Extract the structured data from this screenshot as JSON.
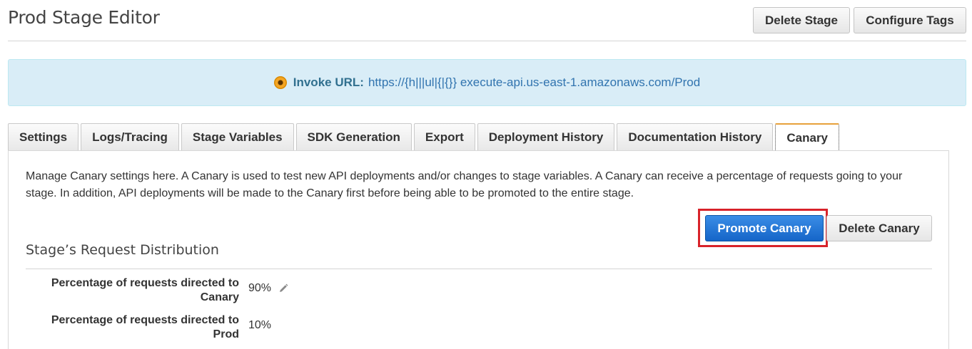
{
  "header": {
    "title": "Prod Stage Editor",
    "delete_stage_label": "Delete Stage",
    "configure_tags_label": "Configure Tags"
  },
  "invoke": {
    "label": "Invoke URL:",
    "url": "https://{h|||ul|{|{}} execute-api.us-east-1.amazonaws.com/Prod",
    "icon": "info-icon"
  },
  "tabs": [
    {
      "label": "Settings",
      "active": false
    },
    {
      "label": "Logs/Tracing",
      "active": false
    },
    {
      "label": "Stage Variables",
      "active": false
    },
    {
      "label": "SDK Generation",
      "active": false
    },
    {
      "label": "Export",
      "active": false
    },
    {
      "label": "Deployment History",
      "active": false
    },
    {
      "label": "Documentation History",
      "active": false
    },
    {
      "label": "Canary",
      "active": true
    }
  ],
  "canary": {
    "description": "Manage Canary settings here. A Canary is used to test new API deployments and/or changes to stage variables. A Canary can receive a percentage of requests going to your stage. In addition, API deployments will be made to the Canary first before being able to be promoted to the entire stage.",
    "promote_label": "Promote Canary",
    "delete_label": "Delete Canary",
    "section_title": "Stage’s Request Distribution",
    "rows": [
      {
        "label": "Percentage of requests directed to Canary",
        "value": "90%",
        "editable": true
      },
      {
        "label": "Percentage of requests directed to Prod",
        "value": "10%",
        "editable": false
      }
    ]
  },
  "colors": {
    "highlight": "#d8232a",
    "primary_button": "#1565c8",
    "banner_bg": "#d9edf7",
    "active_tab_accent": "#e7a13b"
  }
}
